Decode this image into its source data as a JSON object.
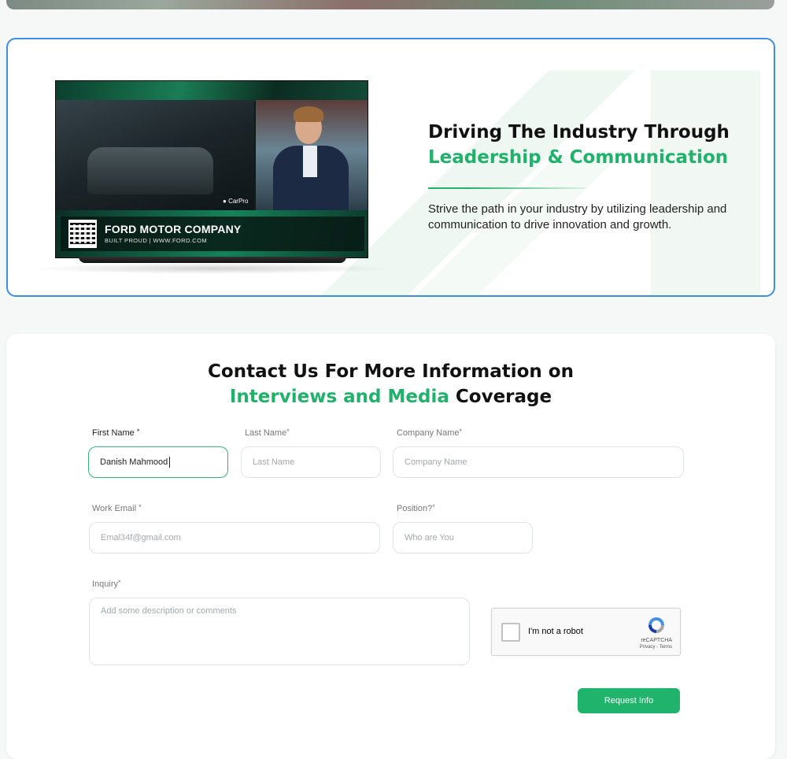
{
  "colors": {
    "accent": "#20b26a",
    "frame_border": "#3b8fe6",
    "button_bg": "#1fb36b"
  },
  "hero": {
    "tv": {
      "company_name": "FORD MOTOR COMPANY",
      "company_tagline": "BUILT PROUD | WWW.FORD.COM",
      "brand_badge": "CarPro"
    },
    "title_line1": "Driving The Industry Through",
    "title_line2": "Leadership & Communication",
    "description": "Strive the path in your industry by utilizing leadership and communication to drive innovation and growth."
  },
  "form": {
    "title_line1": "Contact Us For More Information on",
    "title_line2_highlight": "Interviews and Media",
    "title_line2_rest": "Coverage",
    "required_mark": "*",
    "first_name": {
      "label": "First Name",
      "value": "Danish Mahmood"
    },
    "last_name": {
      "label": "Last Name",
      "placeholder": "Last Name"
    },
    "company_name": {
      "label": "Company Name",
      "placeholder": "Company Name"
    },
    "work_email": {
      "label": "Work Email",
      "placeholder": "Emal34f@gmail.com"
    },
    "position": {
      "label": "Position?",
      "placeholder": "Who are You"
    },
    "inquiry": {
      "label": "Inquiry",
      "placeholder": "Add some description or comments"
    },
    "captcha": {
      "label": "I'm not a robot",
      "brand": "reCAPTCHA",
      "links": "Privacy - Terms"
    },
    "submit_label": "Request Info"
  }
}
